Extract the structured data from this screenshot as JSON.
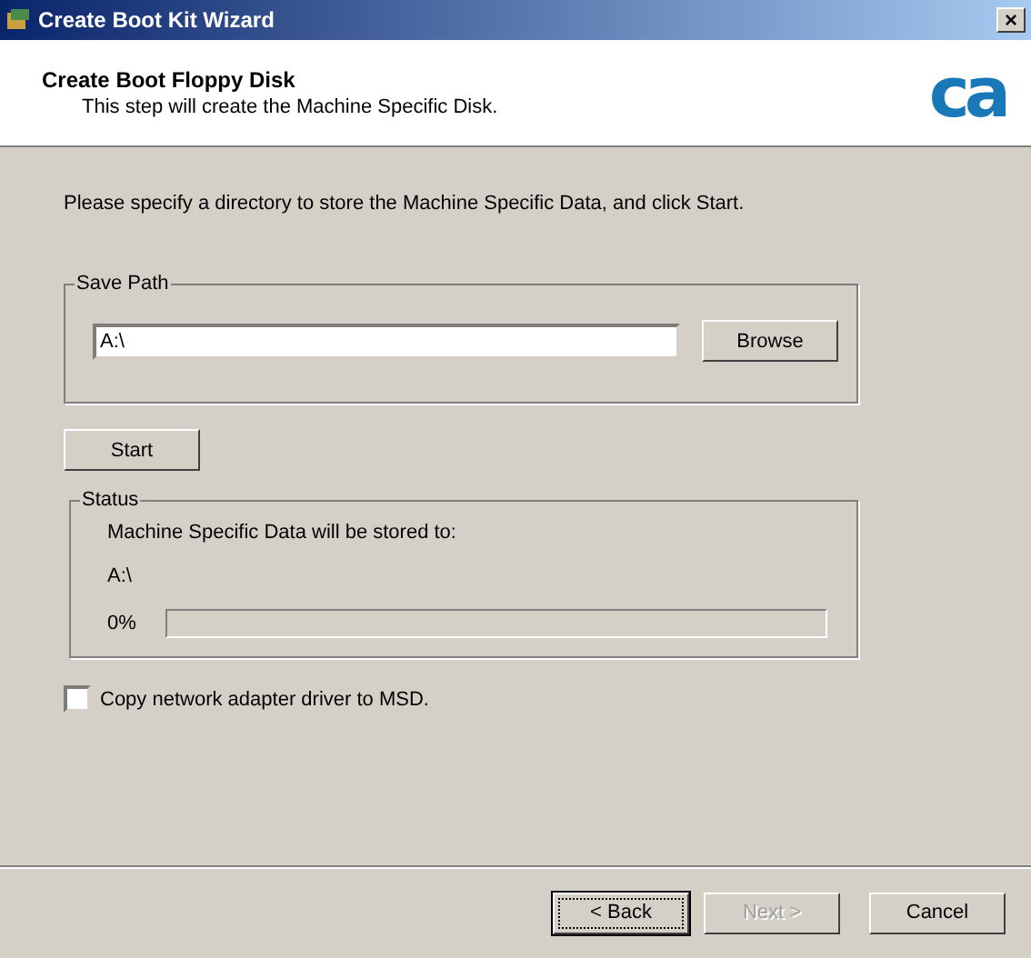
{
  "window": {
    "title": "Create Boot Kit Wizard",
    "close": "×"
  },
  "header": {
    "title": "Create Boot Floppy Disk",
    "subtitle": "This step will create the Machine Specific Disk.",
    "logo": "ca"
  },
  "instruction": "Please specify a directory to store the Machine Specific Data, and click Start.",
  "save_path": {
    "legend": "Save Path",
    "value": "A:\\",
    "browse": "Browse"
  },
  "start": "Start",
  "status": {
    "legend": "Status",
    "message": "Machine Specific Data will be stored to:",
    "path": "A:\\",
    "percent": "0%",
    "level": 0
  },
  "checkbox": {
    "label": "Copy network adapter driver to MSD.",
    "checked": false
  },
  "buttons": [
    {
      "label": "< Back",
      "disabled": false,
      "focused": true
    },
    {
      "label": "Next >",
      "disabled": true,
      "focused": false
    },
    {
      "label": "Cancel",
      "disabled": false,
      "focused": false
    }
  ]
}
